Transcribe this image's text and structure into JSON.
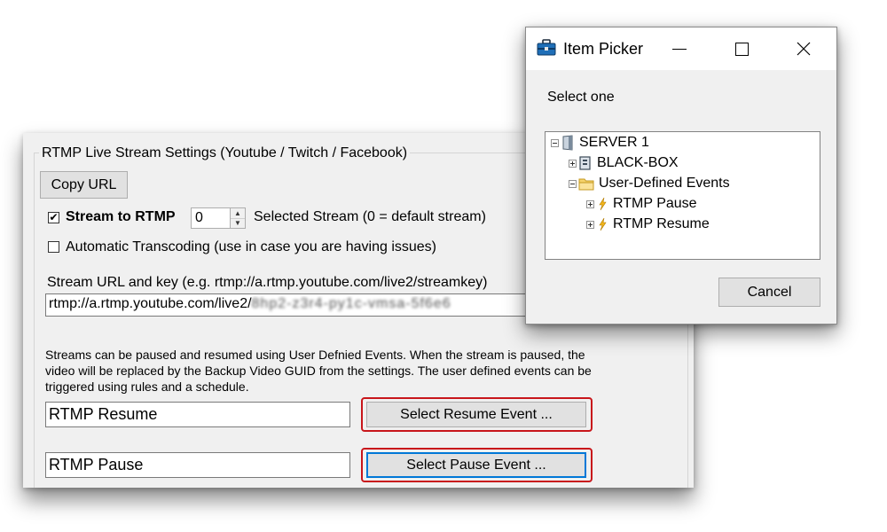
{
  "settings": {
    "group_title": "RTMP Live Stream Settings (Youtube / Twitch / Facebook)",
    "copy_url_label": "Copy URL",
    "stream_to_rtmp": {
      "label": "Stream to RTMP",
      "checked": true,
      "check_mark": "✔"
    },
    "stream_index": {
      "value": "0",
      "label": "Selected Stream (0 = default stream)"
    },
    "auto_transcoding": {
      "label": "Automatic Transcoding (use in case you are having issues)",
      "checked": false
    },
    "stream_url": {
      "label": "Stream URL and key (e.g. rtmp://a.rtmp.youtube.com/live2/streamkey)",
      "value_visible": "rtmp://a.rtmp.youtube.com/live2/",
      "value_redacted": "8hp2-z3r4-py1c-vmsa-5f6e6"
    },
    "info_text": "Streams can be paused and resumed using User Defnied Events. When the stream is paused, the video will be replaced by the Backup Video GUID from the settings. The user defined events can be triggered using rules and a schedule.",
    "resume_event": {
      "value": "RTMP Resume",
      "button_label": "Select Resume Event ..."
    },
    "pause_event": {
      "value": "RTMP Pause",
      "button_label": "Select Pause Event ..."
    },
    "highlight_color": "#c8161b"
  },
  "item_picker": {
    "title": "Item Picker",
    "prompt": "Select one",
    "tree": [
      {
        "label": "SERVER 1",
        "icon": "server-icon",
        "expanded": true,
        "level": 0
      },
      {
        "label": "BLACK-BOX",
        "icon": "computer-icon",
        "expanded": false,
        "level": 1
      },
      {
        "label": "User-Defined Events",
        "icon": "folder-icon",
        "expanded": true,
        "level": 1
      },
      {
        "label": "RTMP Pause",
        "icon": "lightning-icon",
        "expanded": false,
        "level": 2
      },
      {
        "label": "RTMP Resume",
        "icon": "lightning-icon",
        "expanded": false,
        "level": 2
      }
    ],
    "cancel_label": "Cancel"
  }
}
